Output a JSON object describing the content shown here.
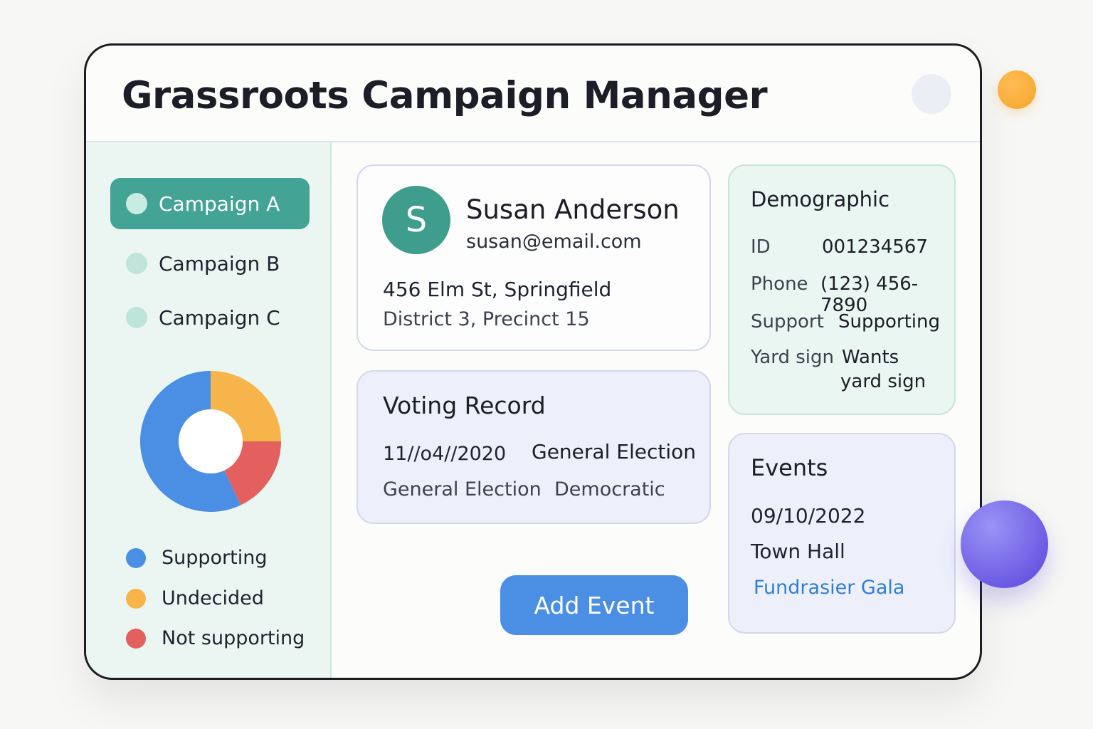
{
  "app": {
    "title": "Grassroots Campaign Manager"
  },
  "sidebar": {
    "campaigns": [
      {
        "label": "Campaign A",
        "active": true
      },
      {
        "label": "Campaign B",
        "active": false
      },
      {
        "label": "Campaign C",
        "active": false
      }
    ],
    "support_chart": {
      "type": "pie",
      "slices": [
        {
          "name": "Supporting",
          "value": 57,
          "color": "#4a8fe4"
        },
        {
          "name": "Undecided",
          "value": 25,
          "color": "#f7b44a"
        },
        {
          "name": "Not supporting",
          "value": 18,
          "color": "#e4605e"
        }
      ]
    },
    "legend": [
      "Supporting",
      "Undecided",
      "Not supporting"
    ]
  },
  "profile": {
    "initial": "S",
    "name": "Susan Anderson",
    "email": "susan@email.com",
    "address_line1": "456 Elm St, Springfield",
    "address_line2": "District 3, Precinct 15"
  },
  "voting_record": {
    "title": "Voting Record",
    "date": "11//o4//2020",
    "election_type": "General Election",
    "election_type2": "General Election",
    "party": "Democratic"
  },
  "actions": {
    "add_event_label": "Add Event"
  },
  "demographic": {
    "title": "Demographic",
    "id_label": "ID",
    "id_value": "001234567",
    "phone_label": "Phone",
    "phone_value": "(123) 456-7890",
    "support_label": "Support",
    "support_value": "Supporting",
    "yard_sign_label": "Yard sign",
    "yard_sign_value_line1": "Wants",
    "yard_sign_value_line2": "yard sign"
  },
  "events": {
    "title": "Events",
    "date": "09/10/2022",
    "event1": "Town Hall",
    "event2": "Fundrasier Gala"
  },
  "colors": {
    "accent_teal": "#43a394",
    "primary_blue": "#4a8fe4",
    "link_blue": "#2f7fd6"
  }
}
